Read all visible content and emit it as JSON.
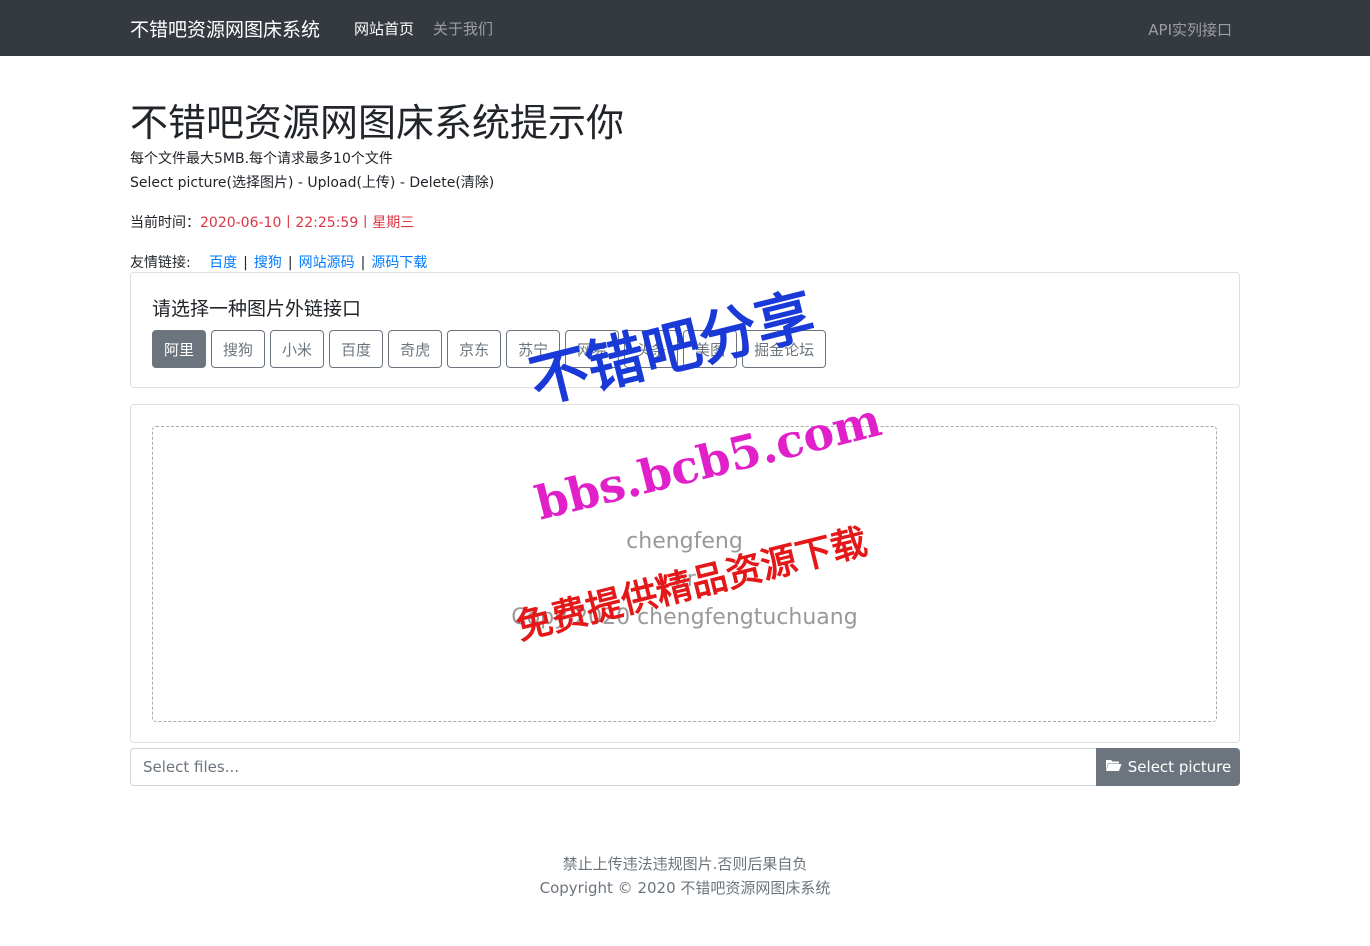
{
  "nav": {
    "brand": "不错吧资源网图床系统",
    "home": "网站首页",
    "about": "关于我们",
    "api": "API实列接口"
  },
  "header": {
    "title": "不错吧资源网图床系统提示你",
    "line1": "每个文件最大5MB.每个请求最多10个文件",
    "line2": "Select picture(选择图片) - Upload(上传) - Delete(清除)"
  },
  "time": {
    "label": "当前时间：",
    "value": "2020-06-10丨22:25:59丨星期三"
  },
  "links": {
    "label": "友情链接:",
    "items": [
      "百度",
      "搜狗",
      "网站源码",
      "源码下载"
    ],
    "separator": "|"
  },
  "interface_card": {
    "title": "请选择一种图片外链接口",
    "buttons": [
      "阿里",
      "搜狗",
      "小米",
      "百度",
      "奇虎",
      "京东",
      "苏宁",
      "网易",
      "头条",
      "美图",
      "掘金论坛"
    ],
    "selected": "阿里"
  },
  "dropzone": {
    "line1": "chengfeng",
    "line2": "or",
    "line3": "Copy 2020 chengfengtuchuang"
  },
  "file_input": {
    "placeholder": "Select files...",
    "button_label": "Select picture",
    "button_icon": "folder-open-icon"
  },
  "footer": {
    "line1": "禁止上传违法违规图片.否则后果自负",
    "line2": "Copyright © 2020 不错吧资源网图床系统"
  },
  "watermark": {
    "line1": "不错吧分享",
    "line2": "bbs.bcb5.com",
    "line3": "免费提供精品资源下载"
  },
  "colors": {
    "navbar": "#343a40",
    "accent_red": "#dc3545",
    "link": "#007bff",
    "secondary": "#6c757d"
  }
}
